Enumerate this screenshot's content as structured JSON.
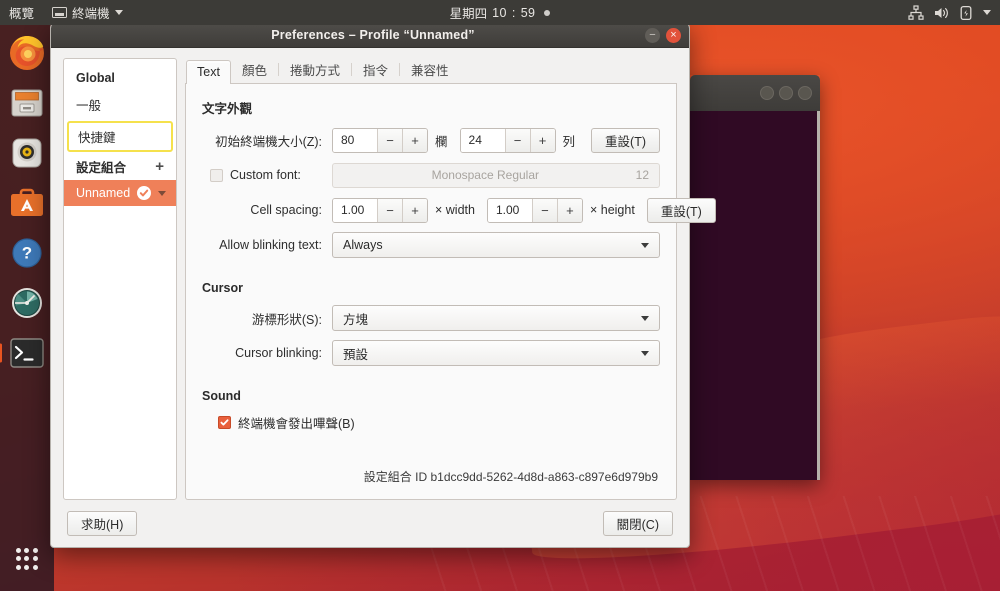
{
  "topbar": {
    "activities": "概覽",
    "app_name": "終端機",
    "app_icon": "window-icon",
    "app_caret": "chevron-down-icon",
    "clock_day": "星期四",
    "clock_hour": "10",
    "clock_sep": ":",
    "clock_minute": "59",
    "tray": [
      "network-icon",
      "volume-icon",
      "power-icon",
      "chevron-down-icon"
    ]
  },
  "dock": {
    "items": [
      {
        "name": "firefox",
        "running": false
      },
      {
        "name": "files",
        "running": false
      },
      {
        "name": "rhythmbox",
        "running": false
      },
      {
        "name": "ubuntu-software",
        "running": false
      },
      {
        "name": "help",
        "running": false
      },
      {
        "name": "disk-usage-analyzer",
        "running": false
      },
      {
        "name": "terminal",
        "running": true
      }
    ],
    "show_applications": "show-applications-grid-icon"
  },
  "background_window": {
    "name": "terminal-window",
    "buttons": [
      "minimize",
      "maximize",
      "close"
    ]
  },
  "dialog": {
    "title": "Preferences – Profile “Unnamed”",
    "window_buttons": {
      "minimize": "−",
      "close": "×"
    },
    "sidebar": {
      "global_heading": "Global",
      "global_items": [
        {
          "label": "一般",
          "state": "normal"
        },
        {
          "label": "快捷鍵",
          "state": "focused"
        }
      ],
      "profiles_heading": "設定組合",
      "add_label": "+",
      "profiles": [
        {
          "label": "Unnamed",
          "state": "selected",
          "check": "check-icon",
          "menu": "chevron-down-icon"
        }
      ]
    },
    "tabs": [
      {
        "label": "Text",
        "active": true
      },
      {
        "label": "顏色",
        "active": false
      },
      {
        "label": "捲動方式",
        "active": false
      },
      {
        "label": "指令",
        "active": false
      },
      {
        "label": "兼容性",
        "active": false
      }
    ],
    "text_tab": {
      "appearance_heading": "文字外觀",
      "terminal_size": {
        "label": "初始終端機大小(Z):",
        "columns_value": "80",
        "columns_unit": "欄",
        "rows_value": "24",
        "rows_unit": "列",
        "reset_label": "重設(T)",
        "minus": "−",
        "plus": "+"
      },
      "custom_font": {
        "label": "Custom font:",
        "checked": false,
        "font_name": "Monospace Regular",
        "font_size": "12"
      },
      "cell_spacing": {
        "label": "Cell spacing:",
        "width_value": "1.00",
        "width_unit": "× width",
        "height_value": "1.00",
        "height_unit": "× height",
        "reset_label": "重設(T)",
        "minus": "−",
        "plus": "+"
      },
      "blinking_text": {
        "label": "Allow blinking text:",
        "value": "Always"
      },
      "cursor_heading": "Cursor",
      "cursor_shape": {
        "label": "游標形狀(S):",
        "value": "方塊"
      },
      "cursor_blinking": {
        "label": "Cursor blinking:",
        "value": "預設"
      },
      "sound_heading": "Sound",
      "bell": {
        "label": "終端機會發出嗶聲(B)",
        "checked": true
      },
      "profile_id_label": "設定組合 ID",
      "profile_id_value": "b1dcc9dd-5262-4d8d-a863-c897e6d979b9"
    },
    "footer": {
      "help_label": "求助(H)",
      "close_label": "關閉(C)"
    }
  },
  "colors": {
    "ubuntu_orange": "#e95420",
    "selection_orange": "#ef8059",
    "focus_yellow": "#f5e14c",
    "topbar_bg": "#3c3b37",
    "dock_bg": "#2f1a23",
    "terminal_bg": "#300a24"
  }
}
